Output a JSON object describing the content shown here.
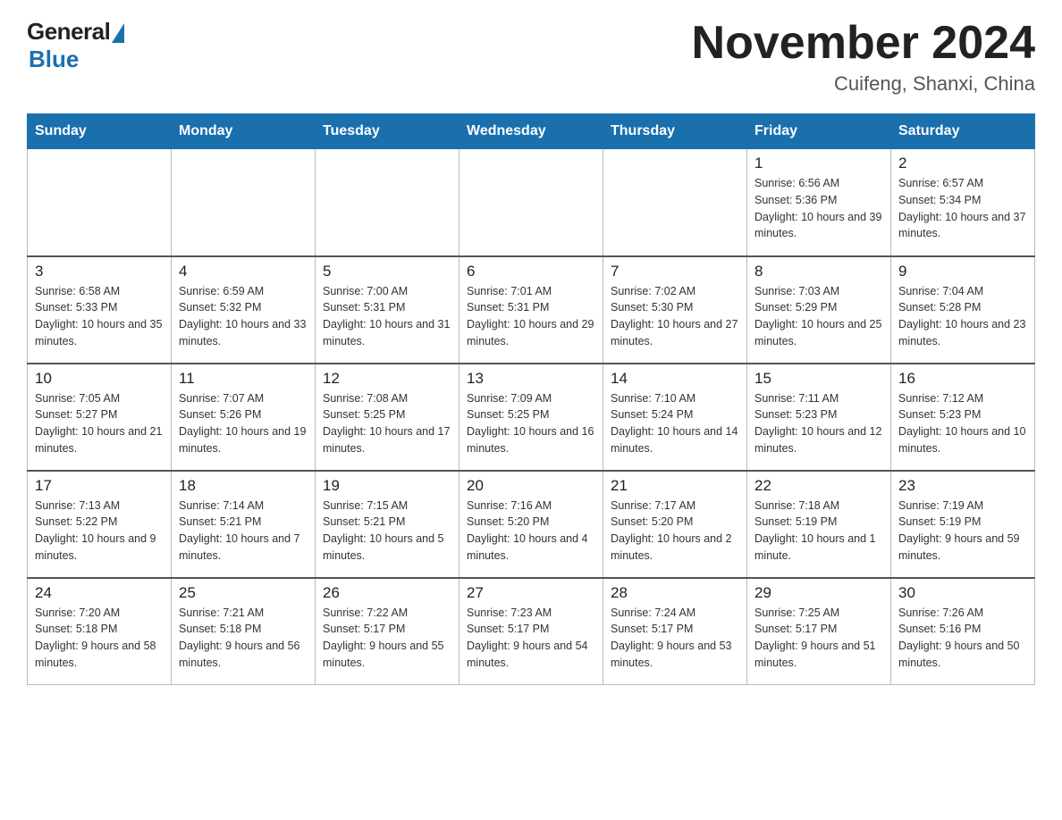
{
  "header": {
    "logo_general": "General",
    "logo_blue": "Blue",
    "month_title": "November 2024",
    "location": "Cuifeng, Shanxi, China"
  },
  "weekdays": [
    "Sunday",
    "Monday",
    "Tuesday",
    "Wednesday",
    "Thursday",
    "Friday",
    "Saturday"
  ],
  "weeks": [
    [
      {
        "day": "",
        "sunrise": "",
        "sunset": "",
        "daylight": ""
      },
      {
        "day": "",
        "sunrise": "",
        "sunset": "",
        "daylight": ""
      },
      {
        "day": "",
        "sunrise": "",
        "sunset": "",
        "daylight": ""
      },
      {
        "day": "",
        "sunrise": "",
        "sunset": "",
        "daylight": ""
      },
      {
        "day": "",
        "sunrise": "",
        "sunset": "",
        "daylight": ""
      },
      {
        "day": "1",
        "sunrise": "Sunrise: 6:56 AM",
        "sunset": "Sunset: 5:36 PM",
        "daylight": "Daylight: 10 hours and 39 minutes."
      },
      {
        "day": "2",
        "sunrise": "Sunrise: 6:57 AM",
        "sunset": "Sunset: 5:34 PM",
        "daylight": "Daylight: 10 hours and 37 minutes."
      }
    ],
    [
      {
        "day": "3",
        "sunrise": "Sunrise: 6:58 AM",
        "sunset": "Sunset: 5:33 PM",
        "daylight": "Daylight: 10 hours and 35 minutes."
      },
      {
        "day": "4",
        "sunrise": "Sunrise: 6:59 AM",
        "sunset": "Sunset: 5:32 PM",
        "daylight": "Daylight: 10 hours and 33 minutes."
      },
      {
        "day": "5",
        "sunrise": "Sunrise: 7:00 AM",
        "sunset": "Sunset: 5:31 PM",
        "daylight": "Daylight: 10 hours and 31 minutes."
      },
      {
        "day": "6",
        "sunrise": "Sunrise: 7:01 AM",
        "sunset": "Sunset: 5:31 PM",
        "daylight": "Daylight: 10 hours and 29 minutes."
      },
      {
        "day": "7",
        "sunrise": "Sunrise: 7:02 AM",
        "sunset": "Sunset: 5:30 PM",
        "daylight": "Daylight: 10 hours and 27 minutes."
      },
      {
        "day": "8",
        "sunrise": "Sunrise: 7:03 AM",
        "sunset": "Sunset: 5:29 PM",
        "daylight": "Daylight: 10 hours and 25 minutes."
      },
      {
        "day": "9",
        "sunrise": "Sunrise: 7:04 AM",
        "sunset": "Sunset: 5:28 PM",
        "daylight": "Daylight: 10 hours and 23 minutes."
      }
    ],
    [
      {
        "day": "10",
        "sunrise": "Sunrise: 7:05 AM",
        "sunset": "Sunset: 5:27 PM",
        "daylight": "Daylight: 10 hours and 21 minutes."
      },
      {
        "day": "11",
        "sunrise": "Sunrise: 7:07 AM",
        "sunset": "Sunset: 5:26 PM",
        "daylight": "Daylight: 10 hours and 19 minutes."
      },
      {
        "day": "12",
        "sunrise": "Sunrise: 7:08 AM",
        "sunset": "Sunset: 5:25 PM",
        "daylight": "Daylight: 10 hours and 17 minutes."
      },
      {
        "day": "13",
        "sunrise": "Sunrise: 7:09 AM",
        "sunset": "Sunset: 5:25 PM",
        "daylight": "Daylight: 10 hours and 16 minutes."
      },
      {
        "day": "14",
        "sunrise": "Sunrise: 7:10 AM",
        "sunset": "Sunset: 5:24 PM",
        "daylight": "Daylight: 10 hours and 14 minutes."
      },
      {
        "day": "15",
        "sunrise": "Sunrise: 7:11 AM",
        "sunset": "Sunset: 5:23 PM",
        "daylight": "Daylight: 10 hours and 12 minutes."
      },
      {
        "day": "16",
        "sunrise": "Sunrise: 7:12 AM",
        "sunset": "Sunset: 5:23 PM",
        "daylight": "Daylight: 10 hours and 10 minutes."
      }
    ],
    [
      {
        "day": "17",
        "sunrise": "Sunrise: 7:13 AM",
        "sunset": "Sunset: 5:22 PM",
        "daylight": "Daylight: 10 hours and 9 minutes."
      },
      {
        "day": "18",
        "sunrise": "Sunrise: 7:14 AM",
        "sunset": "Sunset: 5:21 PM",
        "daylight": "Daylight: 10 hours and 7 minutes."
      },
      {
        "day": "19",
        "sunrise": "Sunrise: 7:15 AM",
        "sunset": "Sunset: 5:21 PM",
        "daylight": "Daylight: 10 hours and 5 minutes."
      },
      {
        "day": "20",
        "sunrise": "Sunrise: 7:16 AM",
        "sunset": "Sunset: 5:20 PM",
        "daylight": "Daylight: 10 hours and 4 minutes."
      },
      {
        "day": "21",
        "sunrise": "Sunrise: 7:17 AM",
        "sunset": "Sunset: 5:20 PM",
        "daylight": "Daylight: 10 hours and 2 minutes."
      },
      {
        "day": "22",
        "sunrise": "Sunrise: 7:18 AM",
        "sunset": "Sunset: 5:19 PM",
        "daylight": "Daylight: 10 hours and 1 minute."
      },
      {
        "day": "23",
        "sunrise": "Sunrise: 7:19 AM",
        "sunset": "Sunset: 5:19 PM",
        "daylight": "Daylight: 9 hours and 59 minutes."
      }
    ],
    [
      {
        "day": "24",
        "sunrise": "Sunrise: 7:20 AM",
        "sunset": "Sunset: 5:18 PM",
        "daylight": "Daylight: 9 hours and 58 minutes."
      },
      {
        "day": "25",
        "sunrise": "Sunrise: 7:21 AM",
        "sunset": "Sunset: 5:18 PM",
        "daylight": "Daylight: 9 hours and 56 minutes."
      },
      {
        "day": "26",
        "sunrise": "Sunrise: 7:22 AM",
        "sunset": "Sunset: 5:17 PM",
        "daylight": "Daylight: 9 hours and 55 minutes."
      },
      {
        "day": "27",
        "sunrise": "Sunrise: 7:23 AM",
        "sunset": "Sunset: 5:17 PM",
        "daylight": "Daylight: 9 hours and 54 minutes."
      },
      {
        "day": "28",
        "sunrise": "Sunrise: 7:24 AM",
        "sunset": "Sunset: 5:17 PM",
        "daylight": "Daylight: 9 hours and 53 minutes."
      },
      {
        "day": "29",
        "sunrise": "Sunrise: 7:25 AM",
        "sunset": "Sunset: 5:17 PM",
        "daylight": "Daylight: 9 hours and 51 minutes."
      },
      {
        "day": "30",
        "sunrise": "Sunrise: 7:26 AM",
        "sunset": "Sunset: 5:16 PM",
        "daylight": "Daylight: 9 hours and 50 minutes."
      }
    ]
  ]
}
